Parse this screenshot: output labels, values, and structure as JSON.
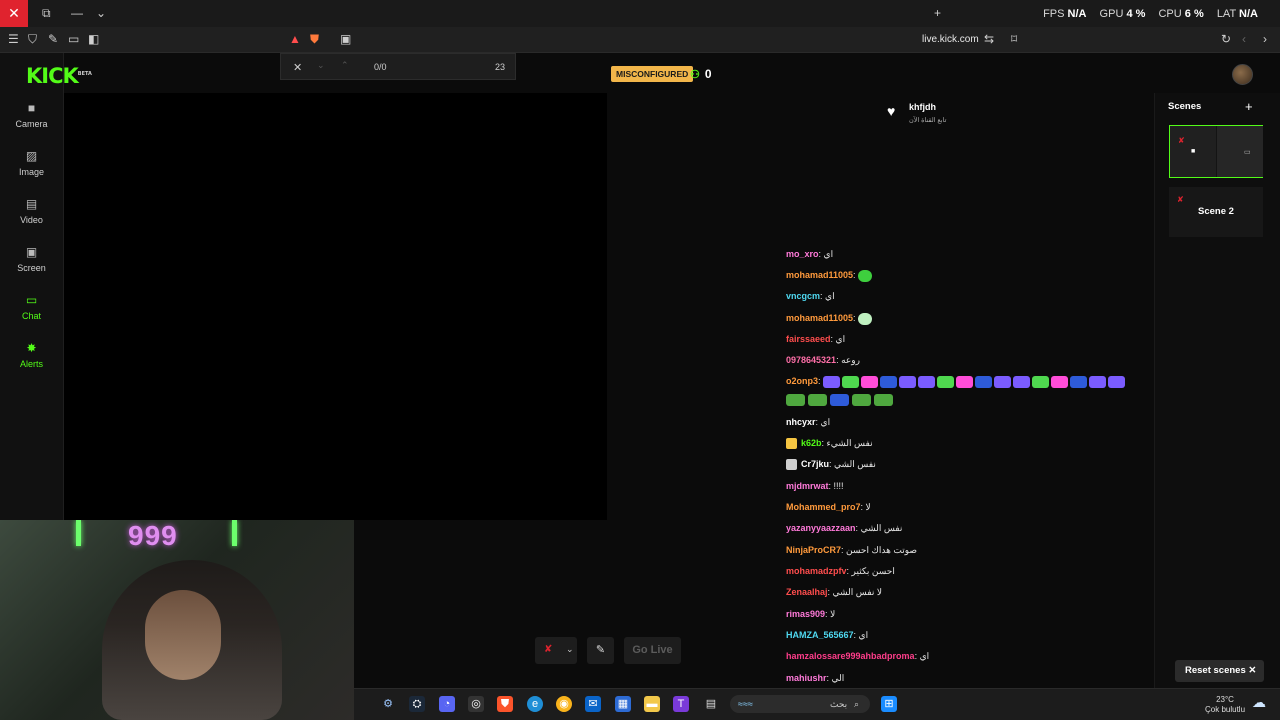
{
  "window": {
    "close": "✕",
    "perf": {
      "fps_label": "FPS",
      "fps": "N/A",
      "gpu_label": "GPU",
      "gpu": "4 %",
      "cpu_label": "CPU",
      "cpu": "6 %",
      "lat_label": "LAT",
      "lat": "N/A"
    }
  },
  "toolbar": {
    "url": "live.kick.com"
  },
  "findbar": {
    "count": "0/0",
    "index": "23"
  },
  "brand": {
    "logo": "KICK",
    "beta": "BETA",
    "accent": "#53fc18"
  },
  "rail": [
    {
      "label": "Camera",
      "icon": "camera-icon"
    },
    {
      "label": "Image",
      "icon": "image-icon"
    },
    {
      "label": "Video",
      "icon": "video-icon"
    },
    {
      "label": "Screen",
      "icon": "screen-icon"
    },
    {
      "label": "Chat",
      "icon": "chat-icon",
      "active": true
    },
    {
      "label": "Alerts",
      "icon": "alerts-icon",
      "active": true
    }
  ],
  "header": {
    "status": "MISCONFIGURED",
    "viewers": "0"
  },
  "webcam": {
    "neon_text": "999"
  },
  "follow": {
    "name": "khfjdh",
    "subtitle": "تابع القناة الآن"
  },
  "chat": [
    {
      "user": "mo_xro",
      "color": "#ff7ad9",
      "msg": "اي"
    },
    {
      "user": "mohamad11005",
      "color": "#ff9a3c",
      "msg": "",
      "emote": "#3ecf3e"
    },
    {
      "user": "vncgcm",
      "color": "#4fd8f0",
      "msg": "اي"
    },
    {
      "user": "mohamad11005",
      "color": "#ff9a3c",
      "msg": "",
      "emote": "#bff0c0"
    },
    {
      "user": "fairssaeed",
      "color": "#ff4d4d",
      "msg": "اي"
    },
    {
      "user": "0978645321",
      "color": "#ff6fa8",
      "msg": "روعه"
    },
    {
      "user": "o2onp3",
      "color": "#ff9a3c",
      "msg": "",
      "emote_row": true
    },
    {
      "user": "nhcyxr",
      "color": "#ffffff",
      "msg": "اي"
    },
    {
      "user": "k62b",
      "color": "#53fc18",
      "msg": "نفس الشيء",
      "badge": "#f5c542"
    },
    {
      "user": "Cr7jku",
      "color": "#ffffff",
      "msg": "نفس الشي",
      "badge": "#cfcfcf"
    },
    {
      "user": "mjdmrwat",
      "color": "#ff7ad9",
      "msg": "!!!!"
    },
    {
      "user": "Mohammed_pro7",
      "color": "#ff9a3c",
      "msg": "لا"
    },
    {
      "user": "yazanyyaazzaan",
      "color": "#ff7ad9",
      "msg": "نفس الشي"
    },
    {
      "user": "NinjaProCR7",
      "color": "#ff9a3c",
      "msg": "صوتت هداك احسن"
    },
    {
      "user": "mohamadzpfv",
      "color": "#ff4d4d",
      "msg": "احسن بكثير"
    },
    {
      "user": "Zenaalhaj",
      "color": "#ff4d4d",
      "msg": "لا نفس الشي"
    },
    {
      "user": "rimas909",
      "color": "#ff7ad9",
      "msg": "لا"
    },
    {
      "user": "HAMZA_565667",
      "color": "#4fd8f0",
      "msg": "اي"
    },
    {
      "user": "hamzalossare999ahbadproma",
      "color": "#ff3d8b",
      "msg": "اي"
    },
    {
      "user": "mahiushr",
      "color": "#ff7ad9",
      "msg": "الي"
    }
  ],
  "controls": {
    "golive": "Go Live"
  },
  "scenes": {
    "title": "Scenes",
    "add": "+",
    "scene2": "Scene 2",
    "reset": "Reset scenes"
  },
  "taskbar": {
    "search_placeholder": "بحث",
    "temp": "23°C",
    "weather": "Çok bulutlu"
  }
}
